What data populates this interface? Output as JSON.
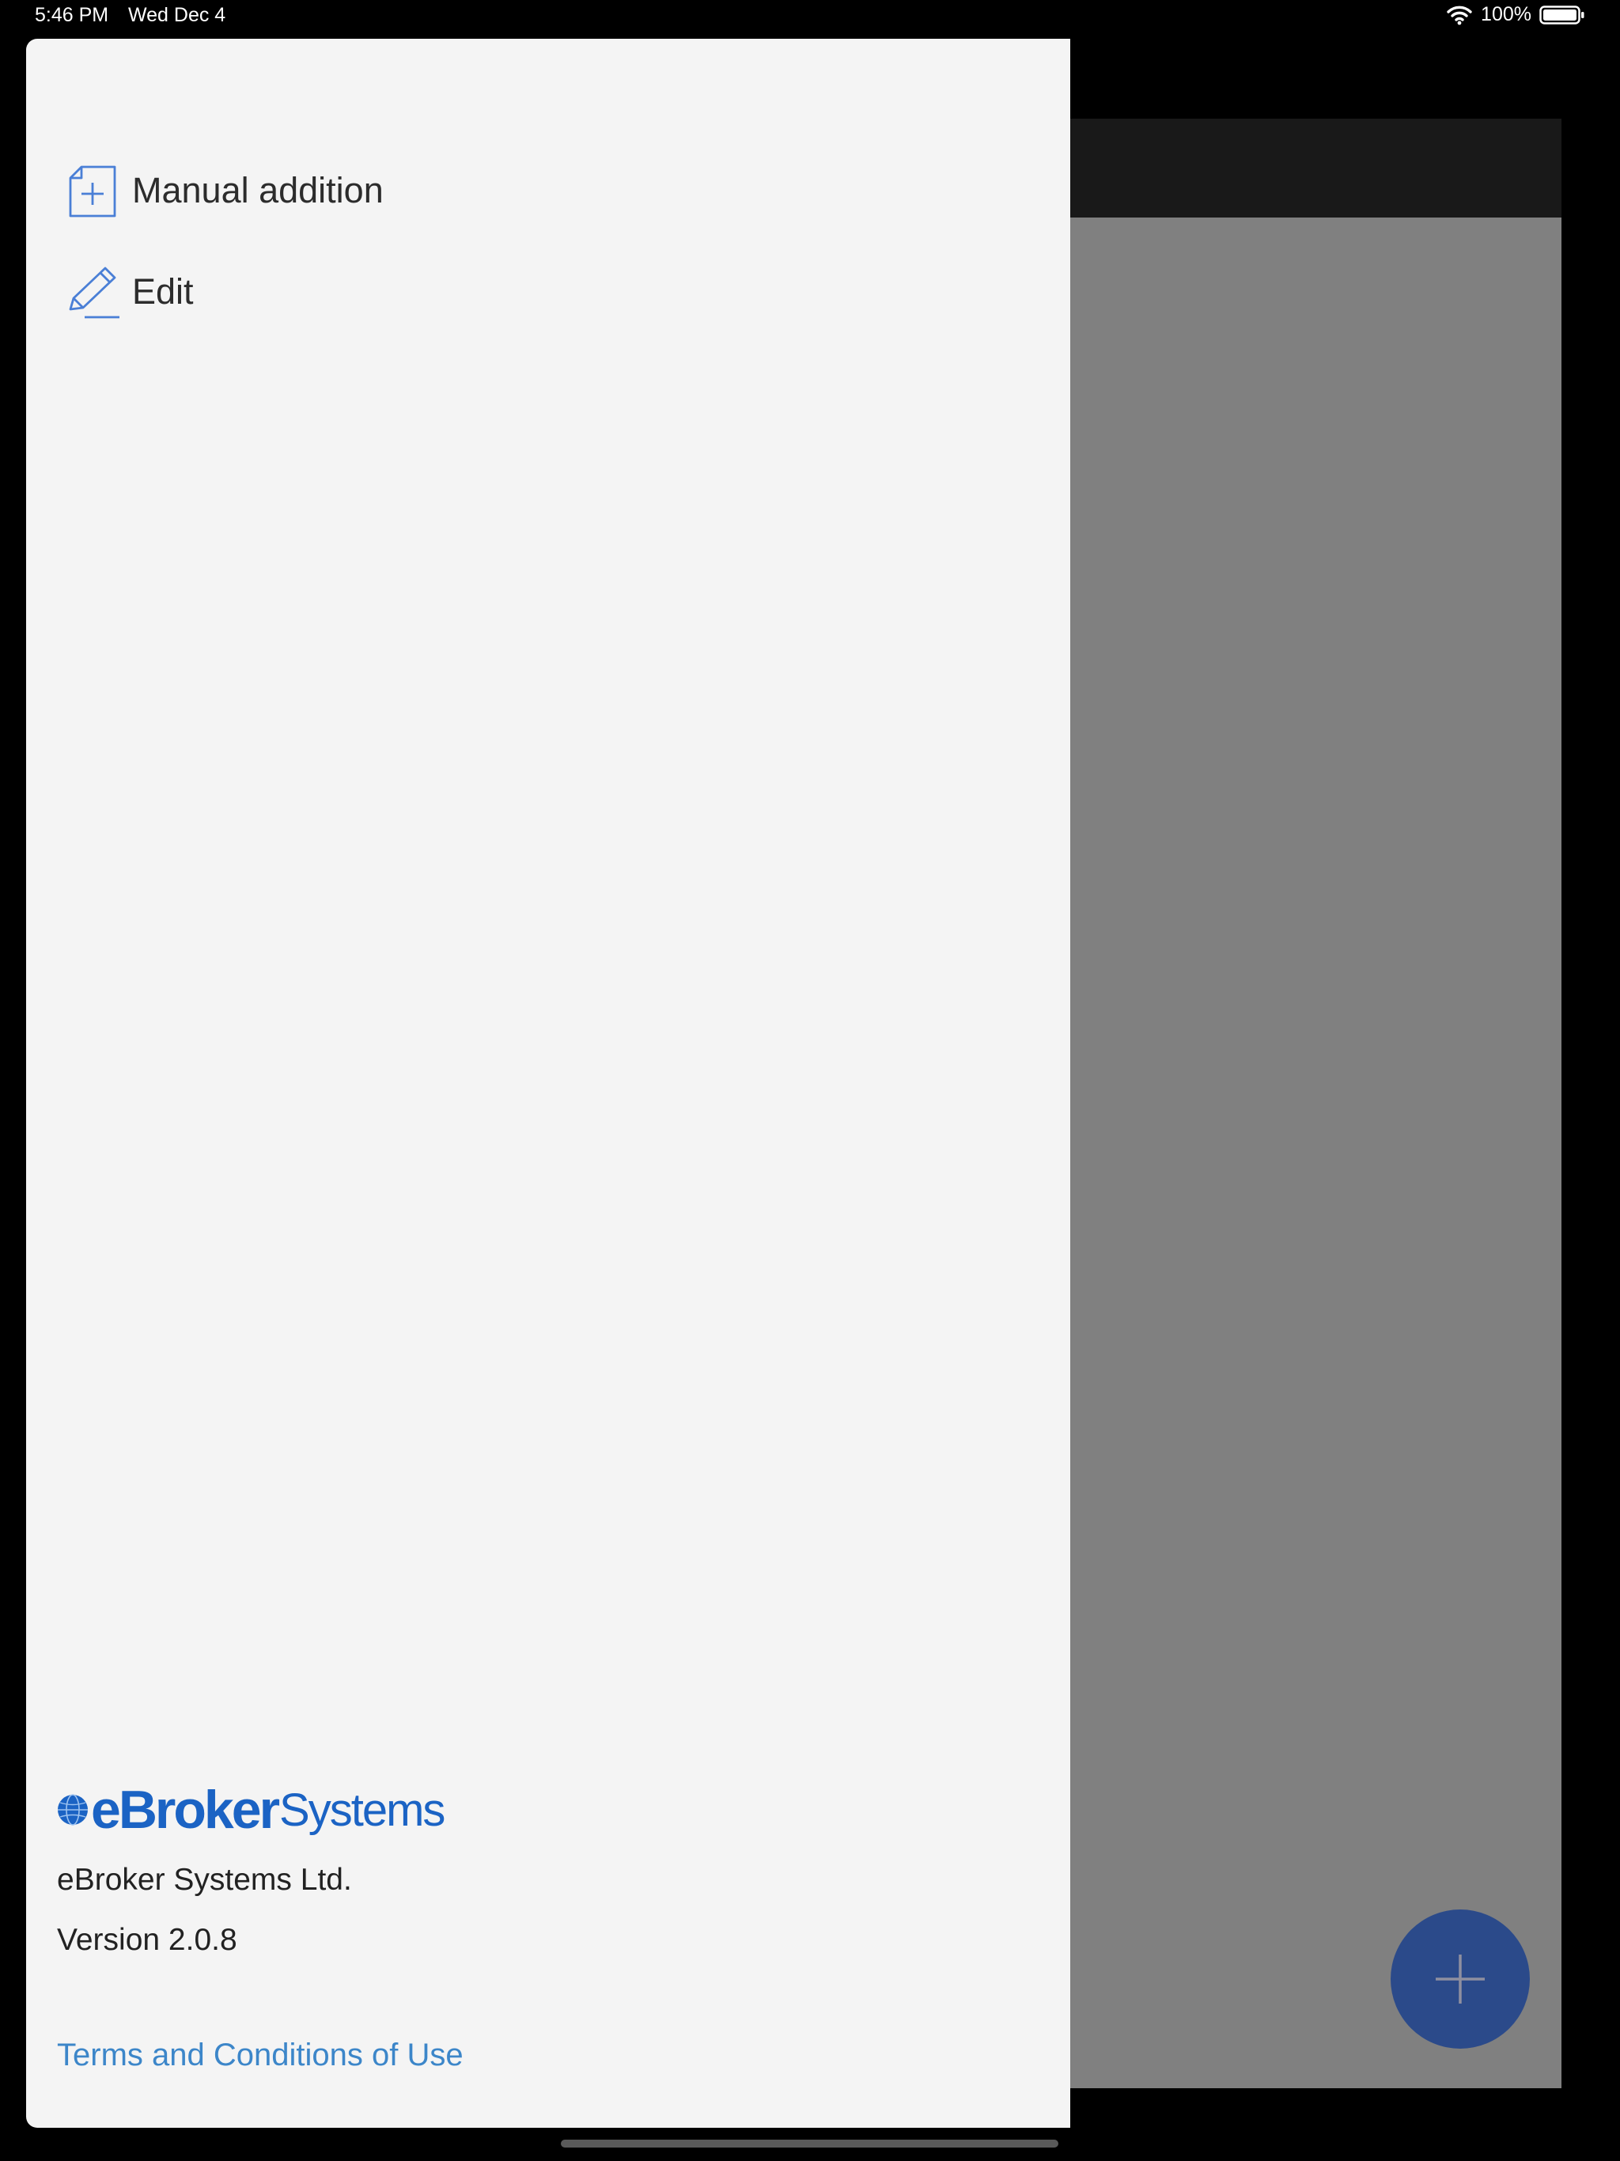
{
  "status_bar": {
    "time": "5:46 PM",
    "date": "Wed Dec 4",
    "battery": "100%",
    "icons": [
      "wifi-icon",
      "battery-icon"
    ]
  },
  "drawer": {
    "menu": [
      {
        "label": "Manual addition",
        "icon": "document-plus-icon"
      },
      {
        "label": "Edit",
        "icon": "pencil-icon"
      }
    ],
    "logo": {
      "bold": "eBroker",
      "light": "Systems"
    },
    "company": "eBroker Systems Ltd.",
    "version": "Version 2.0.8",
    "terms_link": "Terms and Conditions of Use"
  },
  "background_app": {
    "fab_icon": "plus-icon"
  },
  "colors": {
    "accent": "#3c86c9",
    "icon_blue": "#4a7fd6",
    "logo_blue": "#1b63c4",
    "fab": "#2b4a8a",
    "drawer_bg": "#f4f4f4",
    "overlay": "#808080"
  }
}
